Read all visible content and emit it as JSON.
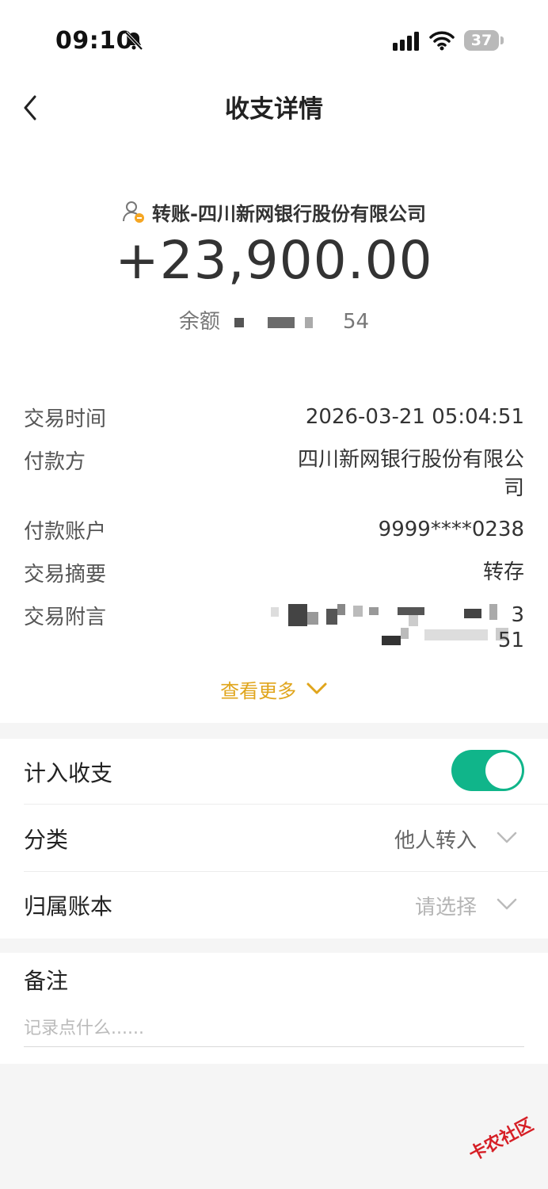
{
  "status_bar": {
    "time": "09:10",
    "battery": "37"
  },
  "header": {
    "title": "收支详情"
  },
  "summary": {
    "counterparty": "转账-四川新网银行股份有限公司",
    "amount": "+23,900.00",
    "balance_label": "余额",
    "balance_visible_tail": "54"
  },
  "details": [
    {
      "label": "交易时间",
      "value": "2026-03-21 05:04:51"
    },
    {
      "label": "付款方",
      "value_line1": "四川新网银行股份有限公",
      "value_line2": "司"
    },
    {
      "label": "付款账户",
      "value": "9999****0238"
    },
    {
      "label": "交易摘要",
      "value": "转存"
    },
    {
      "label": "交易附言",
      "value_tail1": "3",
      "value_tail2": "51"
    }
  ],
  "more_label": "查看更多",
  "settings": {
    "include_label": "计入收支",
    "include_on": true,
    "category_label": "分类",
    "category_value": "他人转入",
    "ledger_label": "归属账本",
    "ledger_placeholder": "请选择"
  },
  "notes": {
    "label": "备注",
    "placeholder": "记录点什么......"
  },
  "watermark": "卡农社区",
  "colors": {
    "accent": "#e0a51c",
    "toggle_on": "#10b58a",
    "watermark": "#d61f26"
  }
}
